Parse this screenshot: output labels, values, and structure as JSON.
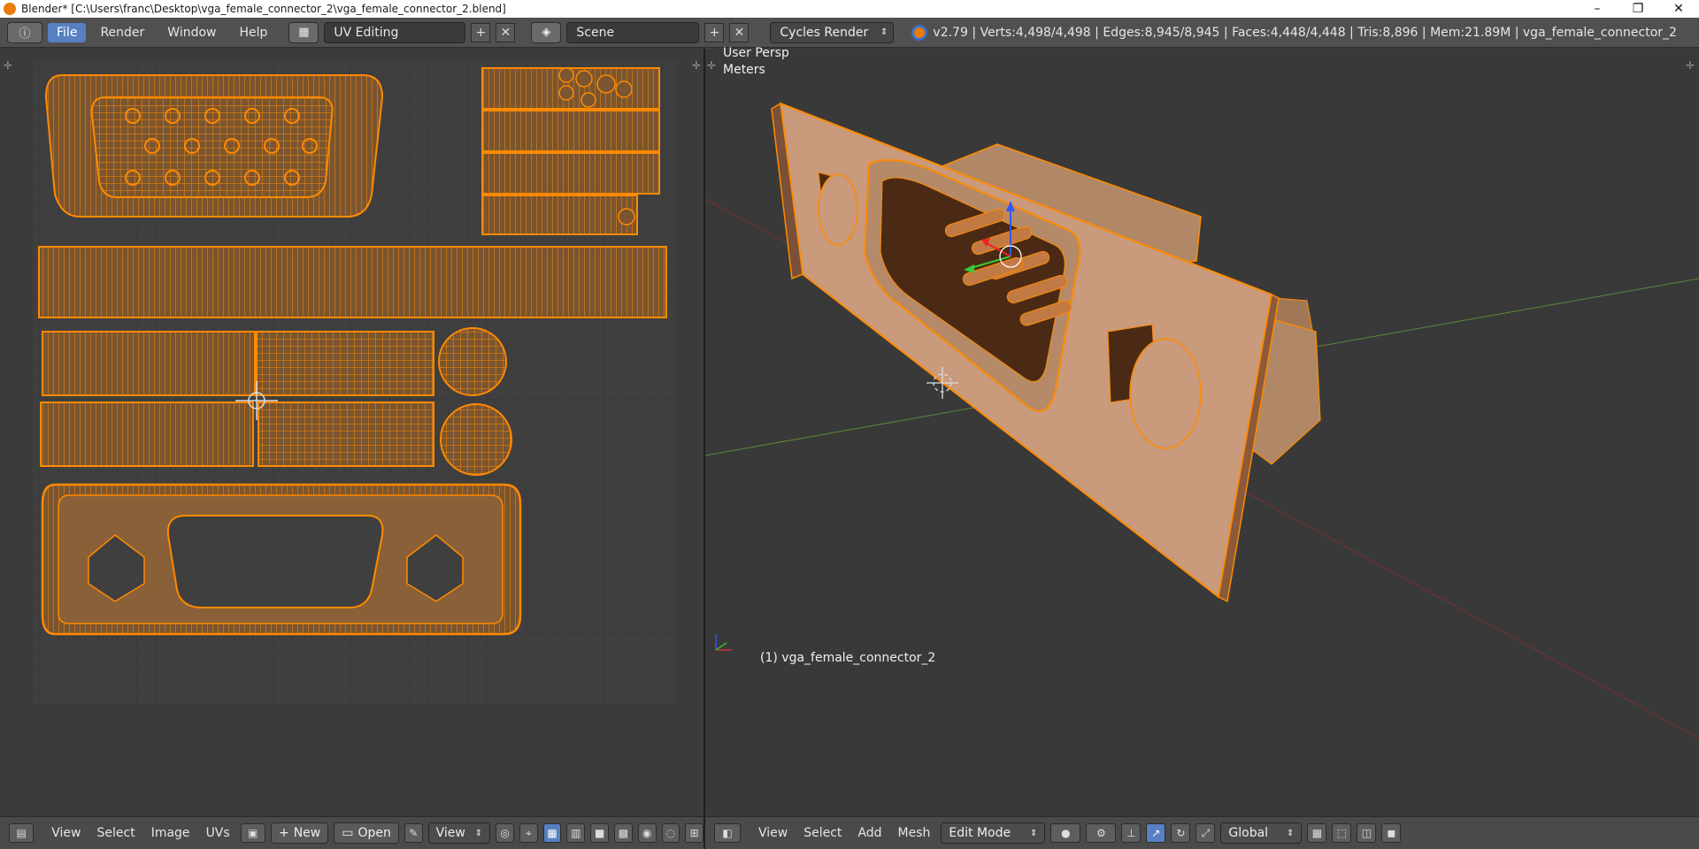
{
  "window": {
    "title": "Blender* [C:\\Users\\franc\\Desktop\\vga_female_connector_2\\vga_female_connector_2.blend]",
    "minimize": "–",
    "restore": "❐",
    "close": "✕"
  },
  "infobar": {
    "info_icon": "ⓘ",
    "menus": [
      "File",
      "Render",
      "Window",
      "Help"
    ],
    "screen_layout": "UV Editing",
    "scene": "Scene",
    "render_engine": "Cycles Render",
    "stats": "v2.79 | Verts:4,498/4,498 | Edges:8,945/8,945 | Faces:4,448/4,448 | Tris:8,896 | Mem:21.89M | vga_female_connector_2"
  },
  "viewport": {
    "view_name": "User Persp",
    "units": "Meters",
    "object_label": "(1) vga_female_connector_2"
  },
  "uv_header": {
    "menus": [
      "View",
      "Select",
      "Image",
      "UVs"
    ],
    "new_label": "New",
    "open_label": "Open",
    "view_label": "View"
  },
  "view3d_header": {
    "menus": [
      "View",
      "Select",
      "Add",
      "Mesh"
    ],
    "mode": "Edit Mode",
    "orientation": "Global"
  },
  "colors": {
    "accent": "#5680c2",
    "uv_wire": "#ff8a00",
    "uv_fill": "#7a5530",
    "mesh_face": "#c79a7a"
  }
}
